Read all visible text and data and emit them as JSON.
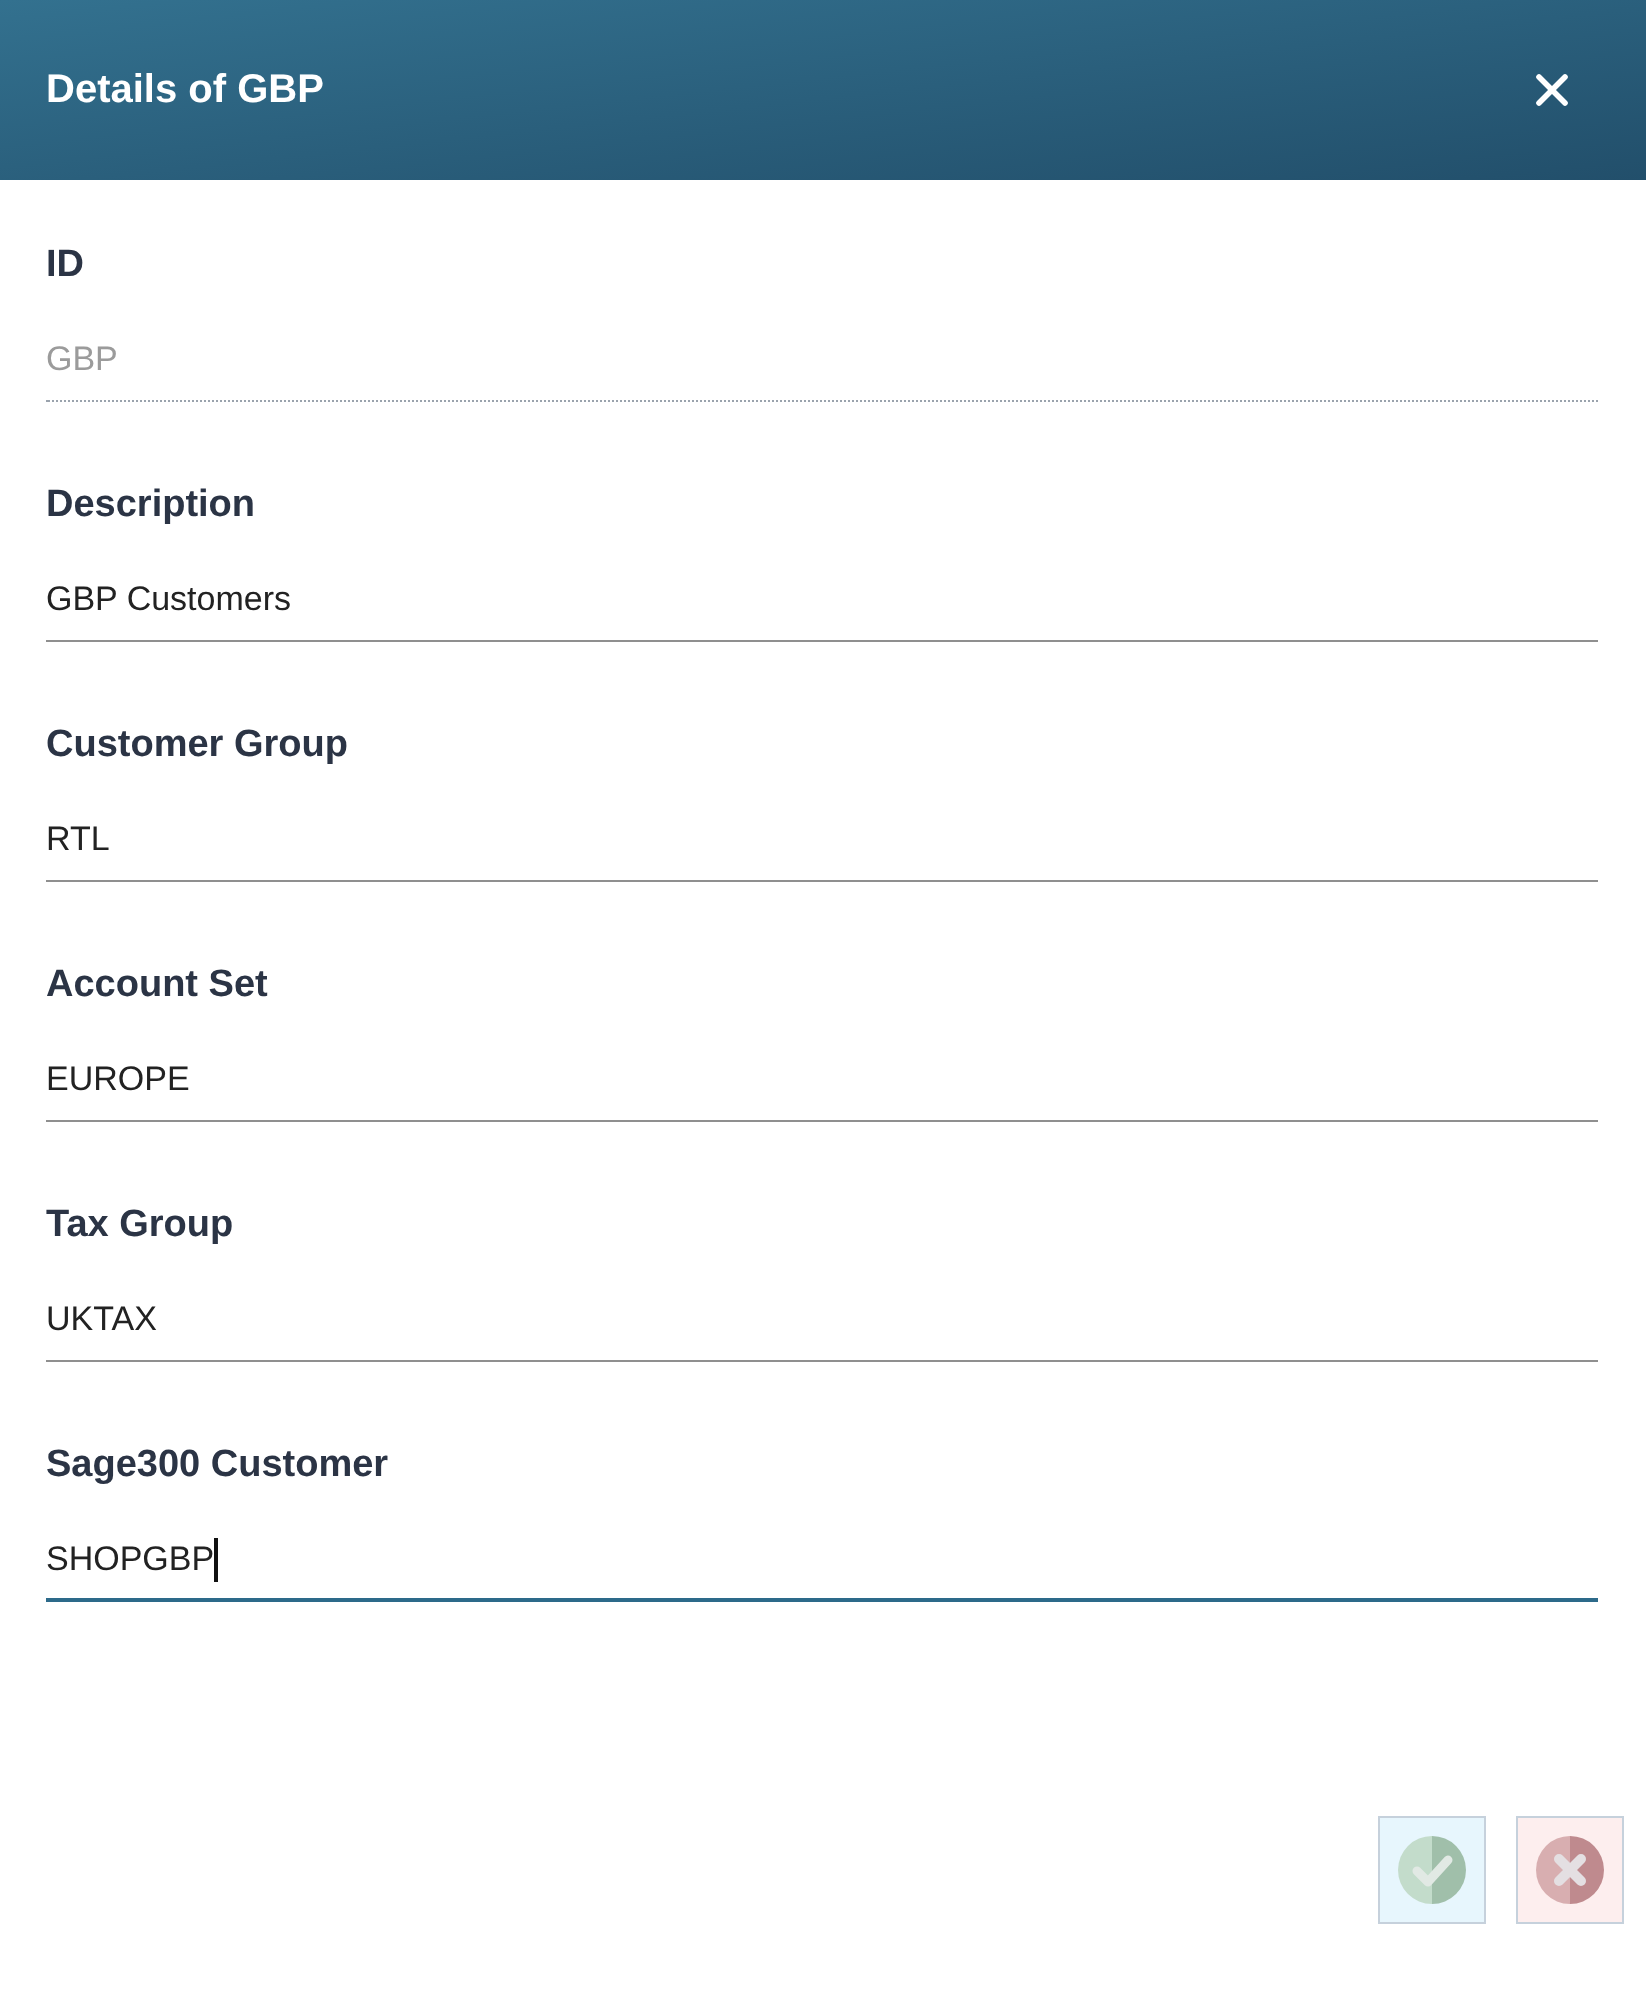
{
  "dialog": {
    "title": "Details of GBP"
  },
  "fields": [
    {
      "label": "ID",
      "value": "GBP",
      "readonly": true,
      "focused": false
    },
    {
      "label": "Description",
      "value": "GBP Customers",
      "readonly": false,
      "focused": false
    },
    {
      "label": "Customer Group",
      "value": "RTL",
      "readonly": false,
      "focused": false
    },
    {
      "label": "Account Set",
      "value": "EUROPE",
      "readonly": false,
      "focused": false
    },
    {
      "label": "Tax Group",
      "value": "UKTAX",
      "readonly": false,
      "focused": false
    },
    {
      "label": "Sage300 Customer",
      "value": "SHOPGBP",
      "readonly": false,
      "focused": true
    }
  ],
  "buttons": [
    {
      "kind": "save",
      "disabled": true
    },
    {
      "kind": "cancel",
      "disabled": true
    }
  ]
}
